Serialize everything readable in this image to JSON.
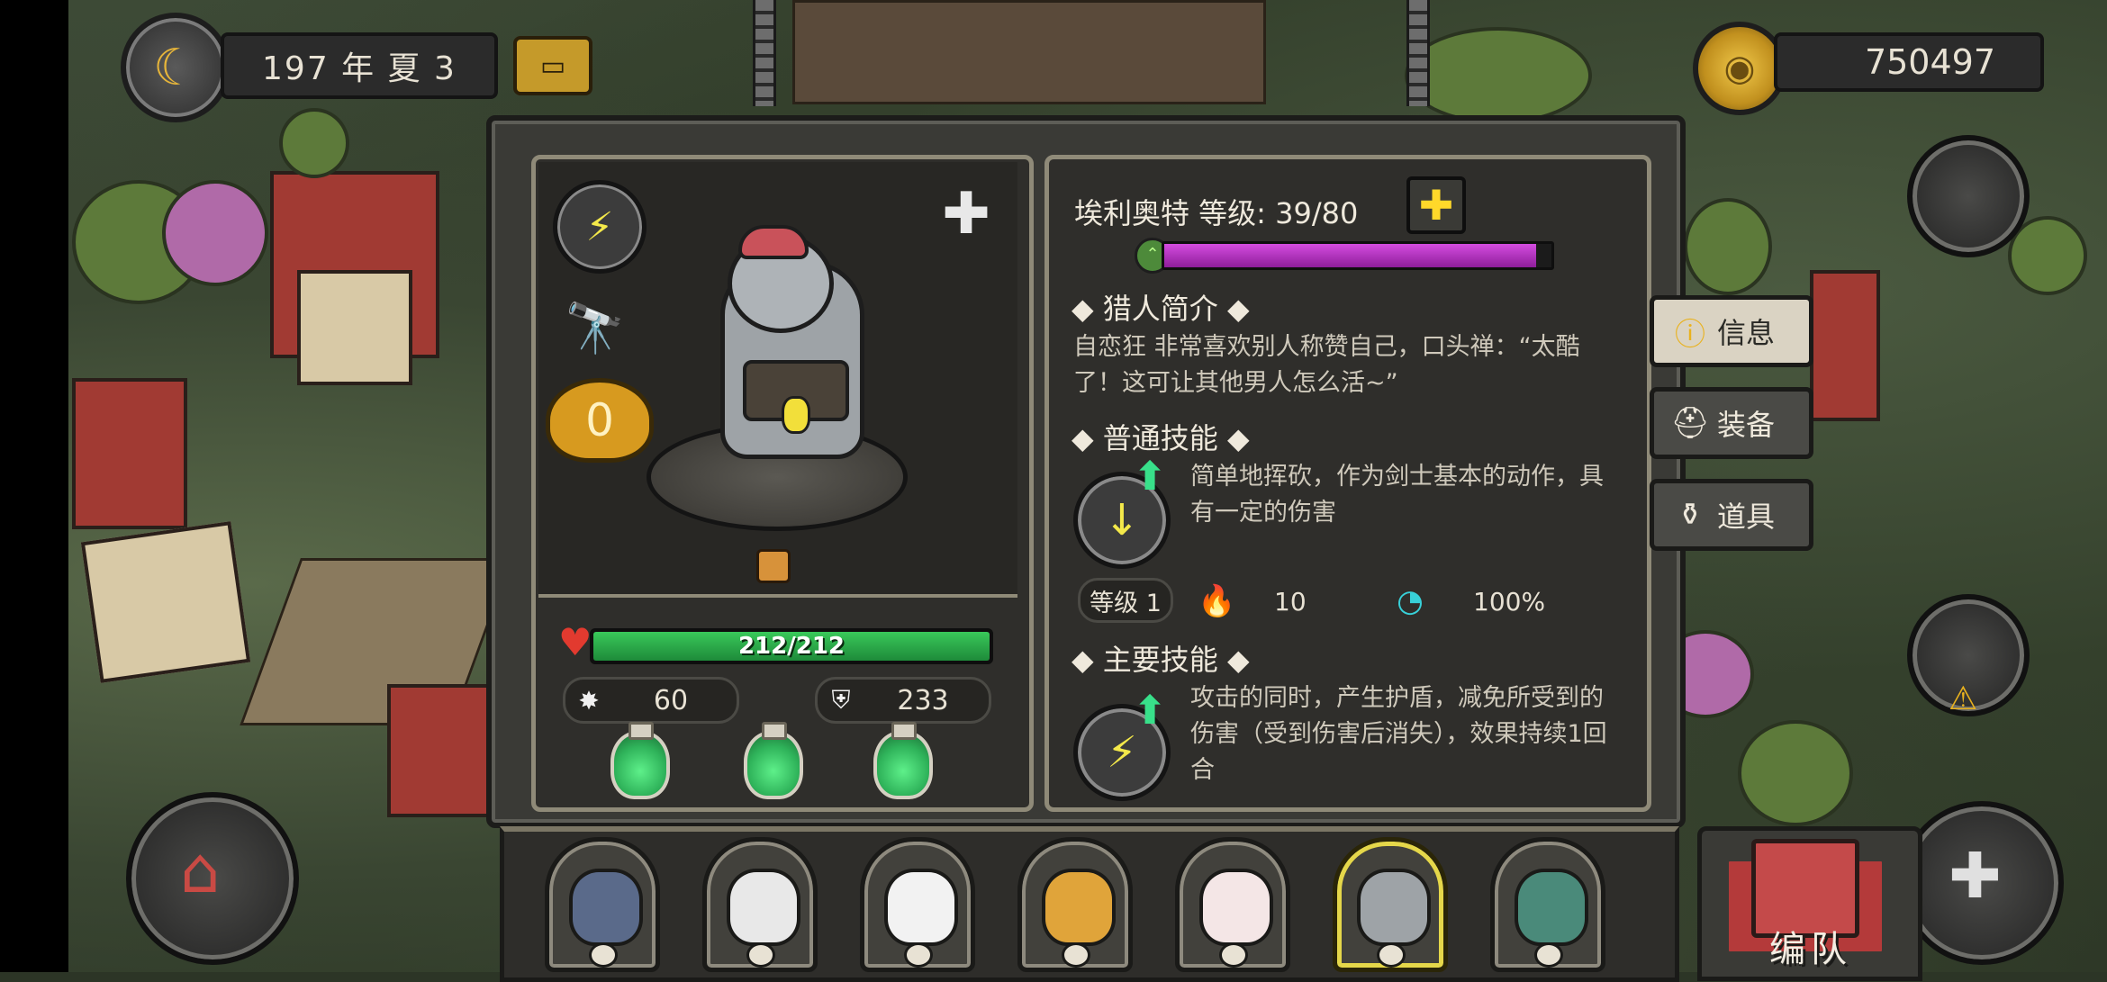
{
  "hud": {
    "date_text": "197 年 夏 3",
    "gold_amount": "750497"
  },
  "hero": {
    "name_level": "埃利奥特  等级: 39/80",
    "xp_fraction": 0.96,
    "hp_text": "212/212",
    "hp_fraction": 1.0,
    "attack": "60",
    "defense": "233",
    "rank": "0"
  },
  "profile": {
    "title": "猎人简介",
    "text": "自恋狂 非常喜欢别人称赞自己，口头禅：“太酷了！这可让其他男人怎么活~”"
  },
  "normal_skill": {
    "title": "普通技能",
    "desc": "简单地挥砍，作为剑士基本的动作，具有一定的伤害",
    "level_label": "等级 1",
    "cost": "10",
    "accuracy": "100%"
  },
  "main_skill": {
    "title": "主要技能",
    "desc": "攻击的同时，产生护盾，减免所受到的伤害（受到伤害后消失），效果持续1回合"
  },
  "tabs": [
    {
      "label": "信息",
      "icon": "info-icon",
      "active": true
    },
    {
      "label": "装备",
      "icon": "helmet-icon",
      "active": false
    },
    {
      "label": "道具",
      "icon": "potion-bag-icon",
      "active": false
    }
  ],
  "formation": {
    "label": "编队"
  },
  "colors": {
    "hp": "#2fb35a",
    "xp": "#b53ac4",
    "accent_gold": "#e9b21e",
    "selected_portrait": "#e5d74a"
  }
}
